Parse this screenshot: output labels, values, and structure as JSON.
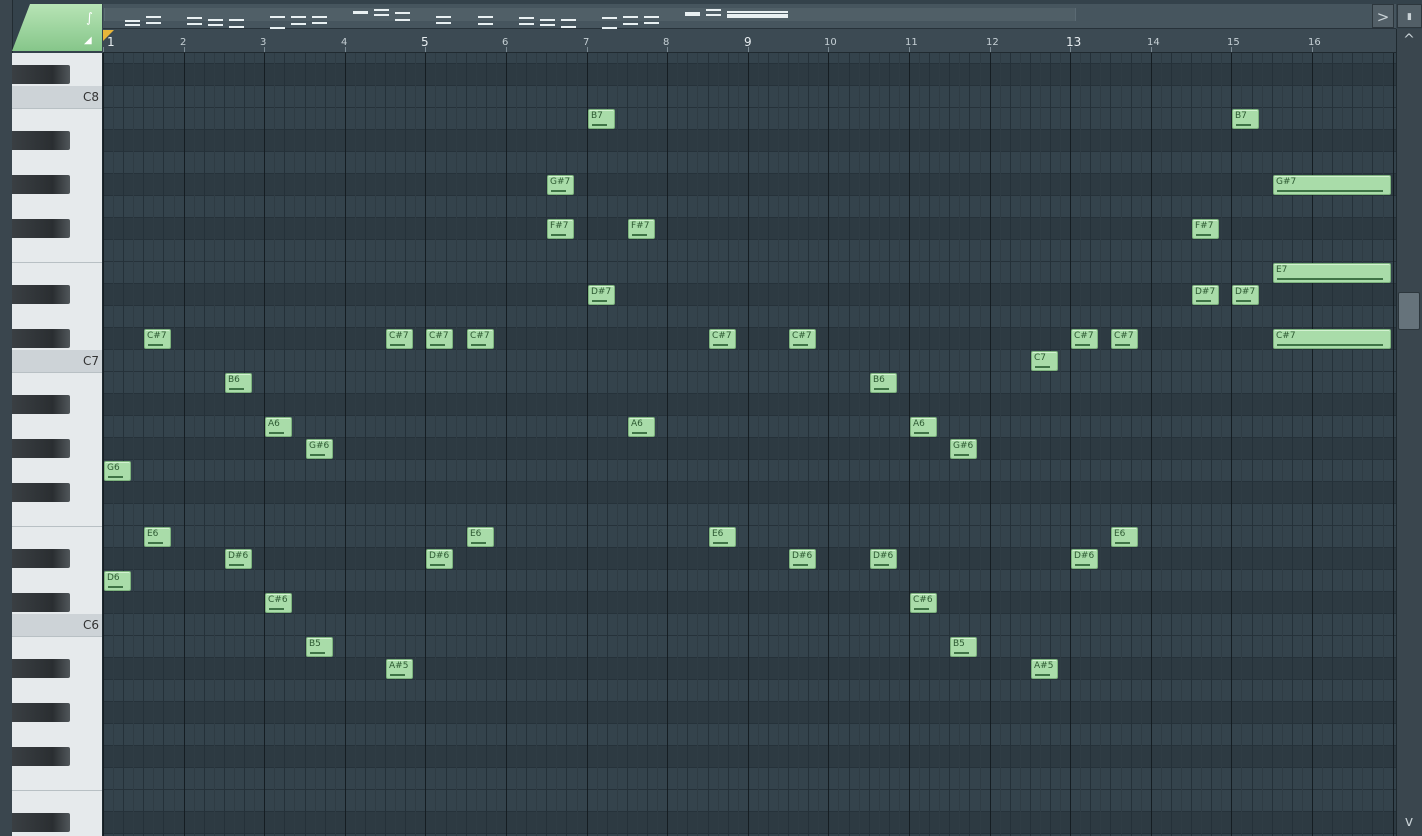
{
  "app": "FL Studio Piano roll",
  "toolbar": {
    "scroll_left": "<",
    "scroll_right": ">",
    "menu_glyph": "▮"
  },
  "vscroll": {
    "up": "^",
    "down": "v"
  },
  "ruler": {
    "bars": [
      {
        "label": "1",
        "big": true
      },
      {
        "label": "2",
        "big": false
      },
      {
        "label": "3",
        "big": false
      },
      {
        "label": "4",
        "big": false
      },
      {
        "label": "5",
        "big": true
      },
      {
        "label": "6",
        "big": false
      },
      {
        "label": "7",
        "big": false
      },
      {
        "label": "8",
        "big": false
      },
      {
        "label": "9",
        "big": true
      },
      {
        "label": "10",
        "big": false
      },
      {
        "label": "11",
        "big": false
      },
      {
        "label": "12",
        "big": false
      },
      {
        "label": "13",
        "big": true
      },
      {
        "label": "14",
        "big": false
      },
      {
        "label": "15",
        "big": false
      },
      {
        "label": "16",
        "big": false
      }
    ]
  },
  "keyboard": {
    "octave_labels": [
      "C8",
      "C7",
      "C6"
    ]
  },
  "notes": [
    {
      "label": "G6",
      "pitch": 91,
      "start": 0,
      "length": 0.75
    },
    {
      "label": "D6",
      "pitch": 86,
      "start": 0,
      "length": 0.75
    },
    {
      "label": "C#7",
      "pitch": 97,
      "start": 1,
      "length": 0.75
    },
    {
      "label": "E6",
      "pitch": 88,
      "start": 1,
      "length": 0.75
    },
    {
      "label": "B6",
      "pitch": 95,
      "start": 3,
      "length": 0.75
    },
    {
      "label": "D#6",
      "pitch": 87,
      "start": 3,
      "length": 0.75
    },
    {
      "label": "A6",
      "pitch": 93,
      "start": 4,
      "length": 0.75
    },
    {
      "label": "C#6",
      "pitch": 85,
      "start": 4,
      "length": 0.75
    },
    {
      "label": "G#6",
      "pitch": 92,
      "start": 5,
      "length": 0.75
    },
    {
      "label": "B5",
      "pitch": 83,
      "start": 5,
      "length": 0.75
    },
    {
      "label": "C#7",
      "pitch": 97,
      "start": 7,
      "length": 0.75
    },
    {
      "label": "A#5",
      "pitch": 82,
      "start": 7,
      "length": 0.75
    },
    {
      "label": "C#7",
      "pitch": 97,
      "start": 8,
      "length": 0.75
    },
    {
      "label": "D#6",
      "pitch": 87,
      "start": 8,
      "length": 0.75
    },
    {
      "label": "C#7",
      "pitch": 97,
      "start": 9,
      "length": 0.75
    },
    {
      "label": "E6",
      "pitch": 88,
      "start": 9,
      "length": 0.75
    },
    {
      "label": "G#7",
      "pitch": 104,
      "start": 11,
      "length": 0.75
    },
    {
      "label": "F#7",
      "pitch": 102,
      "start": 11,
      "length": 0.75
    },
    {
      "label": "B7",
      "pitch": 107,
      "start": 12,
      "length": 0.75
    },
    {
      "label": "D#7",
      "pitch": 99,
      "start": 12,
      "length": 0.75
    },
    {
      "label": "F#7",
      "pitch": 102,
      "start": 13,
      "length": 0.75
    },
    {
      "label": "A6",
      "pitch": 93,
      "start": 13,
      "length": 0.75
    },
    {
      "label": "C#7",
      "pitch": 97,
      "start": 15,
      "length": 0.75
    },
    {
      "label": "E6",
      "pitch": 88,
      "start": 15,
      "length": 0.75
    },
    {
      "label": "C#7",
      "pitch": 97,
      "start": 17,
      "length": 0.75
    },
    {
      "label": "D#6",
      "pitch": 87,
      "start": 17,
      "length": 0.75
    },
    {
      "label": "B6",
      "pitch": 95,
      "start": 19,
      "length": 0.75
    },
    {
      "label": "D#6",
      "pitch": 87,
      "start": 19,
      "length": 0.75
    },
    {
      "label": "A6",
      "pitch": 93,
      "start": 20,
      "length": 0.75
    },
    {
      "label": "C#6",
      "pitch": 85,
      "start": 20,
      "length": 0.75
    },
    {
      "label": "G#6",
      "pitch": 92,
      "start": 21,
      "length": 0.75
    },
    {
      "label": "B5",
      "pitch": 83,
      "start": 21,
      "length": 0.75
    },
    {
      "label": "C7",
      "pitch": 96,
      "start": 23,
      "length": 0.75
    },
    {
      "label": "A#5",
      "pitch": 82,
      "start": 23,
      "length": 0.75
    },
    {
      "label": "C#7",
      "pitch": 97,
      "start": 24,
      "length": 0.75
    },
    {
      "label": "D#6",
      "pitch": 87,
      "start": 24,
      "length": 0.75
    },
    {
      "label": "C#7",
      "pitch": 97,
      "start": 25,
      "length": 0.75
    },
    {
      "label": "E6",
      "pitch": 88,
      "start": 25,
      "length": 0.75
    },
    {
      "label": "F#7",
      "pitch": 102,
      "start": 27,
      "length": 0.75
    },
    {
      "label": "D#7",
      "pitch": 99,
      "start": 27,
      "length": 0.75
    },
    {
      "label": "B7",
      "pitch": 107,
      "start": 28,
      "length": 0.75
    },
    {
      "label": "D#7",
      "pitch": 99,
      "start": 28,
      "length": 0.75
    },
    {
      "label": "G#7",
      "pitch": 104,
      "start": 29,
      "length": 3
    },
    {
      "label": "E7",
      "pitch": 100,
      "start": 29,
      "length": 3
    },
    {
      "label": "C#7",
      "pitch": 97,
      "start": 29,
      "length": 3
    }
  ],
  "colors": {
    "note_fill": "#a9dca9",
    "note_border": "#7cb27d",
    "grid_bg": "#34434c",
    "accent": "#86c68a",
    "playhead": "#e8b63a"
  }
}
